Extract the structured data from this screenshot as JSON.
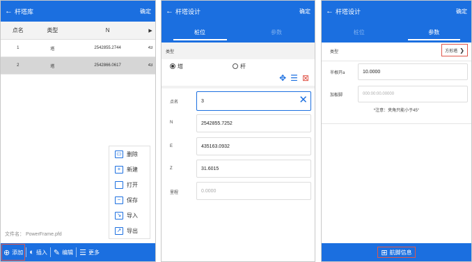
{
  "screen1": {
    "header": {
      "back": "←",
      "title": "杆塔库",
      "confirm": "确定"
    },
    "columns": [
      "点名",
      "类型",
      "N",
      "▶"
    ],
    "rows": [
      {
        "name": "1",
        "type": "塔",
        "n": "2542855.2744",
        "e": "43"
      },
      {
        "name": "2",
        "type": "塔",
        "n": "2542866.0617",
        "e": "43"
      }
    ],
    "menu": [
      "删除",
      "新建",
      "打开",
      "保存",
      "导入",
      "导出"
    ],
    "filename": "文件名：  PowerFrame.pfd",
    "bottom": {
      "add": "添加",
      "insert": "插入",
      "edit": "编辑",
      "more": "更多"
    }
  },
  "screen2": {
    "header": {
      "back": "←",
      "title": "杆塔设计",
      "confirm": "确定"
    },
    "tabs": [
      "桩位",
      "参数"
    ],
    "type_label": "类型",
    "radio_tower": "塔",
    "radio_pole": "杆",
    "fields": {
      "point_label": "点名",
      "point_value": "3",
      "n_label": "N",
      "n_value": "2542855.7252",
      "e_label": "E",
      "e_value": "435163.0932",
      "z_label": "Z",
      "z_value": "31.6015",
      "mileage_label": "里程",
      "mileage_placeholder": "0.0000"
    }
  },
  "screen3": {
    "header": {
      "back": "←",
      "title": "杆塔设计",
      "confirm": "确定"
    },
    "tabs": [
      "桩位",
      "参数"
    ],
    "type_label": "类型",
    "type_button": "方形塔",
    "root_label": "半根开a",
    "root_value": "10.0000",
    "angle_label": "加板脚",
    "angle_placeholder": "000:00:00.00000",
    "note": "*注意：夹角只能小于45°",
    "footer_button": "航脚信息"
  },
  "colors": {
    "primary": "#1b6fe0",
    "highlight": "#e0564a"
  }
}
